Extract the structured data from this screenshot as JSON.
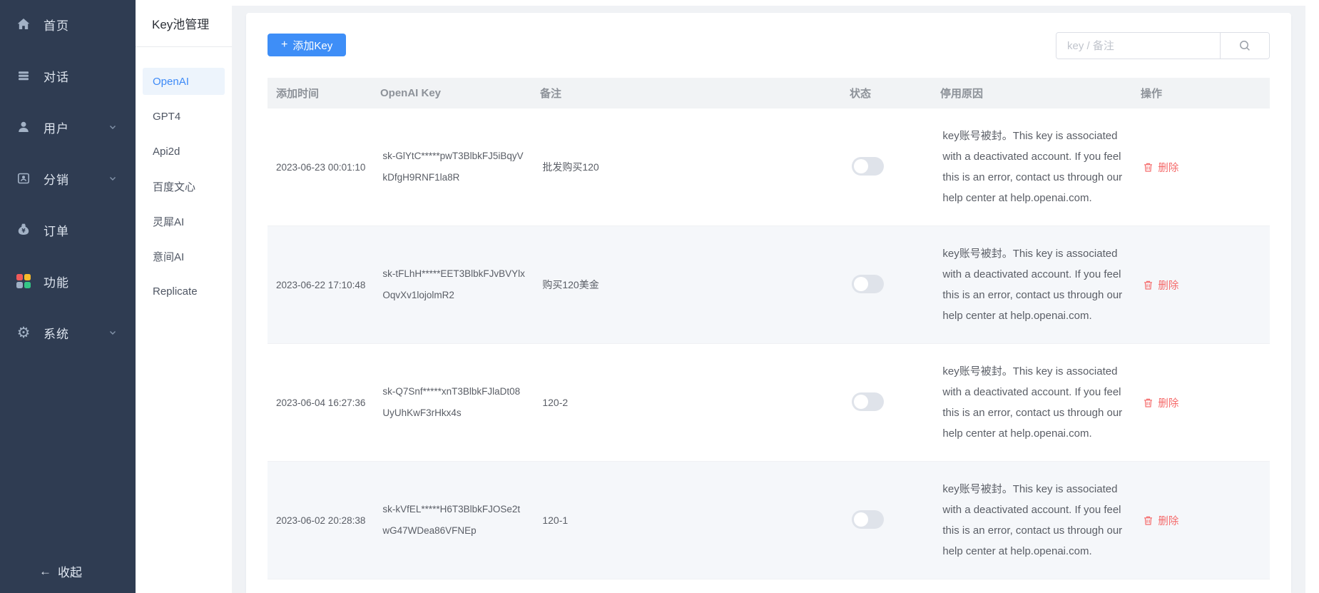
{
  "colors": {
    "sidebar_bg": "#2f3c52",
    "accent_blue": "#3e8ef7",
    "active_item_blue": "#3d8af7",
    "danger_red": "#f56c6c",
    "main_bg": "#f0f2f5",
    "table_header_bg": "#f1f3f5",
    "stripe_bg": "#f5f7fa"
  },
  "sidebar": {
    "items": [
      {
        "label": "首页",
        "icon": "home-icon",
        "has_chevron": false
      },
      {
        "label": "对话",
        "icon": "chat-icon",
        "has_chevron": false
      },
      {
        "label": "用户",
        "icon": "user-icon",
        "has_chevron": true
      },
      {
        "label": "分销",
        "icon": "distribution-icon",
        "has_chevron": true
      },
      {
        "label": "订单",
        "icon": "order-icon",
        "has_chevron": false
      },
      {
        "label": "功能",
        "icon": "features-icon",
        "has_chevron": false
      },
      {
        "label": "系统",
        "icon": "system-icon",
        "has_chevron": true
      }
    ],
    "collapse_label": "收起",
    "collapse_arrow": "←"
  },
  "submenu": {
    "title": "Key池管理",
    "items": [
      {
        "label": "OpenAI",
        "active": true
      },
      {
        "label": "GPT4",
        "active": false
      },
      {
        "label": "Api2d",
        "active": false
      },
      {
        "label": "百度文心",
        "active": false
      },
      {
        "label": "灵犀AI",
        "active": false
      },
      {
        "label": "意间AI",
        "active": false
      },
      {
        "label": "Replicate",
        "active": false
      }
    ]
  },
  "toolbar": {
    "add_button_plus": "+",
    "add_button_label": "添加Key",
    "search_placeholder": "key / 备注"
  },
  "table": {
    "columns": [
      "添加时间",
      "OpenAI Key",
      "备注",
      "状态",
      "停用原因",
      "操作"
    ],
    "delete_label": "删除",
    "rows": [
      {
        "added_at": "2023-06-23 00:01:10",
        "key": "sk-GlYtC*****pwT3BlbkFJ5iBqyVkDfgH9RNF1la8R",
        "remark": "批发购买120",
        "status_on": false,
        "disable_reason": "key账号被封。This key is associated with a deactivated account. If you feel this is an error, contact us through our help center at help.openai.com."
      },
      {
        "added_at": "2023-06-22 17:10:48",
        "key": "sk-tFLhH*****EET3BlbkFJvBVYlxOqvXv1lojolmR2",
        "remark": "购买120美金",
        "status_on": false,
        "disable_reason": "key账号被封。This key is associated with a deactivated account. If you feel this is an error, contact us through our help center at help.openai.com."
      },
      {
        "added_at": "2023-06-04 16:27:36",
        "key": "sk-Q7Snf*****xnT3BlbkFJlaDt08UyUhKwF3rHkx4s",
        "remark": "120-2",
        "status_on": false,
        "disable_reason": "key账号被封。This key is associated with a deactivated account. If you feel this is an error, contact us through our help center at help.openai.com."
      },
      {
        "added_at": "2023-06-02 20:28:38",
        "key": "sk-kVfEL*****H6T3BlbkFJOSe2twG47WDea86VFNEp",
        "remark": "120-1",
        "status_on": false,
        "disable_reason": "key账号被封。This key is associated with a deactivated account. If you feel this is an error, contact us through our help center at help.openai.com."
      }
    ]
  }
}
